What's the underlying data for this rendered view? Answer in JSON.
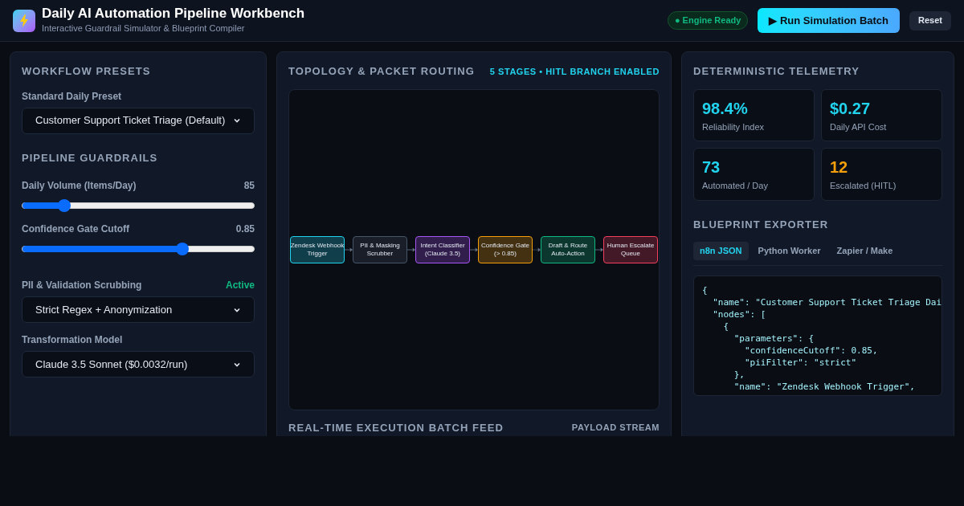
{
  "header": {
    "title": "Daily AI Automation Pipeline Workbench",
    "subtitle": "Interactive Guardrail Simulator & Blueprint Compiler",
    "status": "● Engine Ready",
    "run_button": "▶ Run Simulation Batch",
    "reset_button": "Reset"
  },
  "presets": {
    "heading": "WORKFLOW PRESETS",
    "label": "Standard Daily Preset",
    "value": "Customer Support Ticket Triage (Default)"
  },
  "guardrails": {
    "heading": "PIPELINE GUARDRAILS",
    "sliders": [
      {
        "label": "Daily Volume (Items/Day)",
        "reading": "85",
        "level": 0.18
      },
      {
        "label": "Confidence Gate Cutoff",
        "reading": "0.85",
        "level": 0.69
      }
    ],
    "pii": {
      "label": "PII & Validation Scrubbing",
      "status": "Active",
      "value": "Strict Regex + Anonymization"
    },
    "model": {
      "label": "Transformation Model",
      "value": "Claude 3.5 Sonnet ($0.0032/run)"
    }
  },
  "topology": {
    "heading": "TOPOLOGY & PACKET ROUTING",
    "badge": "5 STAGES • HITL BRANCH ENABLED",
    "nodes": [
      {
        "lines": [
          "Zendesk Webhook",
          "Trigger"
        ],
        "color": "#22d3ee",
        "dashed_link": false
      },
      {
        "lines": [
          "PII & Masking",
          "Scrubber"
        ],
        "color": "#475569",
        "dashed_link": false
      },
      {
        "lines": [
          "Intent Classifier",
          "(Claude 3.5)"
        ],
        "color": "#a855f7",
        "dashed_link": false
      },
      {
        "lines": [
          "Confidence Gate",
          "(> 0.85)"
        ],
        "color": "#f59e0b",
        "dashed_link": true
      },
      {
        "lines": [
          "Draft & Route",
          "Auto-Action"
        ],
        "color": "#10b981",
        "dashed_link": false
      },
      {
        "lines": [
          "Human Escalate",
          "Queue"
        ],
        "color": "#f43f5e"
      }
    ]
  },
  "feed": {
    "heading": "REAL-TIME EXECUTION BATCH FEED",
    "badge": "PAYLOAD STREAM"
  },
  "telemetry": {
    "heading": "DETERMINISTIC TELEMETRY",
    "cards": [
      {
        "value": "98.4%",
        "label": "Reliability Index",
        "color": "#22d3ee"
      },
      {
        "value": "$0.27",
        "label": "Daily API Cost",
        "color": "#22d3ee"
      },
      {
        "value": "73",
        "label": "Automated / Day",
        "color": "#22d3ee"
      },
      {
        "value": "12",
        "label": "Escalated (HITL)",
        "color": "#f59e0b"
      }
    ]
  },
  "exporter": {
    "heading": "BLUEPRINT EXPORTER",
    "tabs": [
      {
        "label": "n8n JSON",
        "selected": true
      },
      {
        "label": "Python Worker",
        "selected": false
      },
      {
        "label": "Zapier / Make",
        "selected": false
      }
    ],
    "code": [
      "{",
      "  \"name\": \"Customer Support Ticket Triage Dai",
      "  \"nodes\": [",
      "    {",
      "      \"parameters\": {",
      "        \"confidenceCutoff\": 0.85,",
      "        \"piiFilter\": \"strict\"",
      "      },",
      "      \"name\": \"Zendesk Webhook Trigger\","
    ]
  }
}
